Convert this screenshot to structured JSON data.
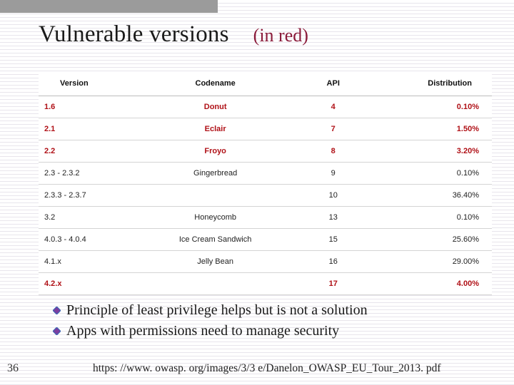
{
  "title": {
    "main": "Vulnerable versions",
    "note": "(in red)"
  },
  "chart_data": {
    "type": "table",
    "columns": [
      "Version",
      "Codename",
      "API",
      "Distribution"
    ],
    "rows": [
      {
        "version": "1.6",
        "codename": "Donut",
        "api": "4",
        "distribution": "0.10%",
        "vulnerable": true
      },
      {
        "version": "2.1",
        "codename": "Eclair",
        "api": "7",
        "distribution": "1.50%",
        "vulnerable": true
      },
      {
        "version": "2.2",
        "codename": "Froyo",
        "api": "8",
        "distribution": "3.20%",
        "vulnerable": true
      },
      {
        "version": "2.3 - 2.3.2",
        "codename": "Gingerbread",
        "api": "9",
        "distribution": "0.10%",
        "vulnerable": false
      },
      {
        "version": "2.3.3 - 2.3.7",
        "codename": "",
        "api": "10",
        "distribution": "36.40%",
        "vulnerable": false
      },
      {
        "version": "3.2",
        "codename": "Honeycomb",
        "api": "13",
        "distribution": "0.10%",
        "vulnerable": false
      },
      {
        "version": "4.0.3 - 4.0.4",
        "codename": "Ice Cream Sandwich",
        "api": "15",
        "distribution": "25.60%",
        "vulnerable": false
      },
      {
        "version": "4.1.x",
        "codename": "Jelly Bean",
        "api": "16",
        "distribution": "29.00%",
        "vulnerable": false
      },
      {
        "version": "4.2.x",
        "codename": "",
        "api": "17",
        "distribution": "4.00%",
        "vulnerable": true
      }
    ]
  },
  "bullets": [
    "Principle of least privilege helps but is not a solution",
    "Apps with permissions need to manage security"
  ],
  "footer": {
    "page": "36",
    "url": "https: //www. owasp. org/images/3/3 e/Danelon_OWASP_EU_Tour_2013. pdf"
  },
  "colors": {
    "vulnerable": "#b01117",
    "title_note": "#8a1a3a",
    "diamond_fill": "#7a3fa0",
    "diamond_stroke": "#3a67b5"
  }
}
